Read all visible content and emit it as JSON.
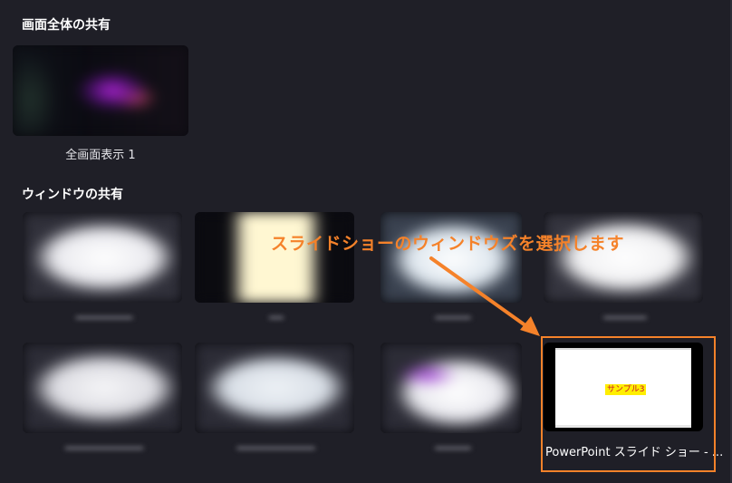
{
  "sections": {
    "full_screen": {
      "title": "画面全体の共有",
      "items": [
        {
          "caption": "全画面表示 1"
        }
      ]
    },
    "windows": {
      "title": "ウィンドウの共有",
      "selected_item": {
        "caption": "PowerPoint スライド ショー - ...",
        "slide_text": "サンプル3"
      }
    }
  },
  "annotation": {
    "text": "スライドショーのウィンドウズを選択します"
  },
  "colors": {
    "background": "#1f1f27",
    "accent": "#f5822a",
    "slide_label_bg": "#ffee00",
    "slide_label_text": "#c8102e"
  }
}
